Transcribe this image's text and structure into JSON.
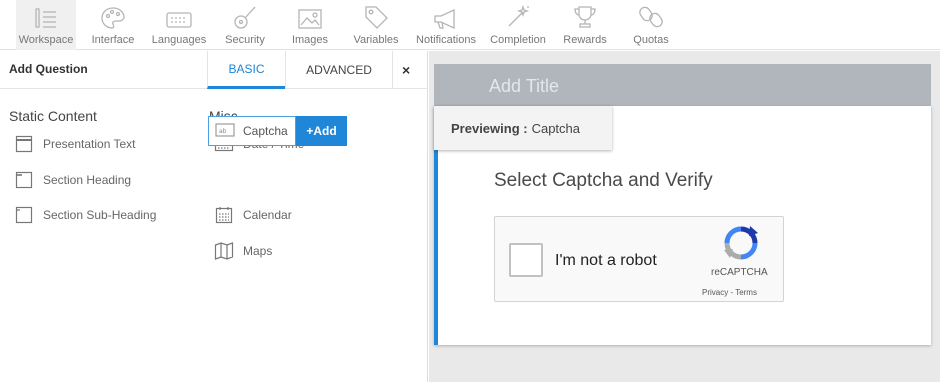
{
  "toolbar": {
    "items": [
      {
        "label": "Workspace",
        "icon": "workspace-icon"
      },
      {
        "label": "Interface",
        "icon": "palette-icon"
      },
      {
        "label": "Languages",
        "icon": "keyboard-icon"
      },
      {
        "label": "Security",
        "icon": "guitar-icon"
      },
      {
        "label": "Images",
        "icon": "image-icon"
      },
      {
        "label": "Variables",
        "icon": "tag-icon"
      },
      {
        "label": "Notifications",
        "icon": "megaphone-icon"
      },
      {
        "label": "Completion",
        "icon": "magic-wand-icon"
      },
      {
        "label": "Rewards",
        "icon": "trophy-icon"
      },
      {
        "label": "Quotas",
        "icon": "chain-link-icon"
      }
    ]
  },
  "panel": {
    "title": "Add Question",
    "tabs": {
      "basic": "BASIC",
      "advanced": "ADVANCED"
    },
    "close": "×",
    "static_content": {
      "title": "Static Content",
      "items": [
        "Presentation Text",
        "Section Heading",
        "Section Sub-Heading"
      ]
    },
    "misc": {
      "title": "Misc",
      "items": [
        "Date / Time",
        "Captcha",
        "Calendar",
        "Maps"
      ],
      "add_button": "+Add"
    }
  },
  "preview": {
    "title_placeholder": "Add Title",
    "previewing_label": "Previewing :",
    "previewing_value": "Captcha",
    "question": "Select Captcha and Verify",
    "recaptcha": {
      "label": "I'm not a robot",
      "brand": "reCAPTCHA",
      "links": "Privacy - Terms"
    }
  },
  "colors": {
    "accent": "#1f86d8",
    "title_bar": "#b1b6bc"
  }
}
